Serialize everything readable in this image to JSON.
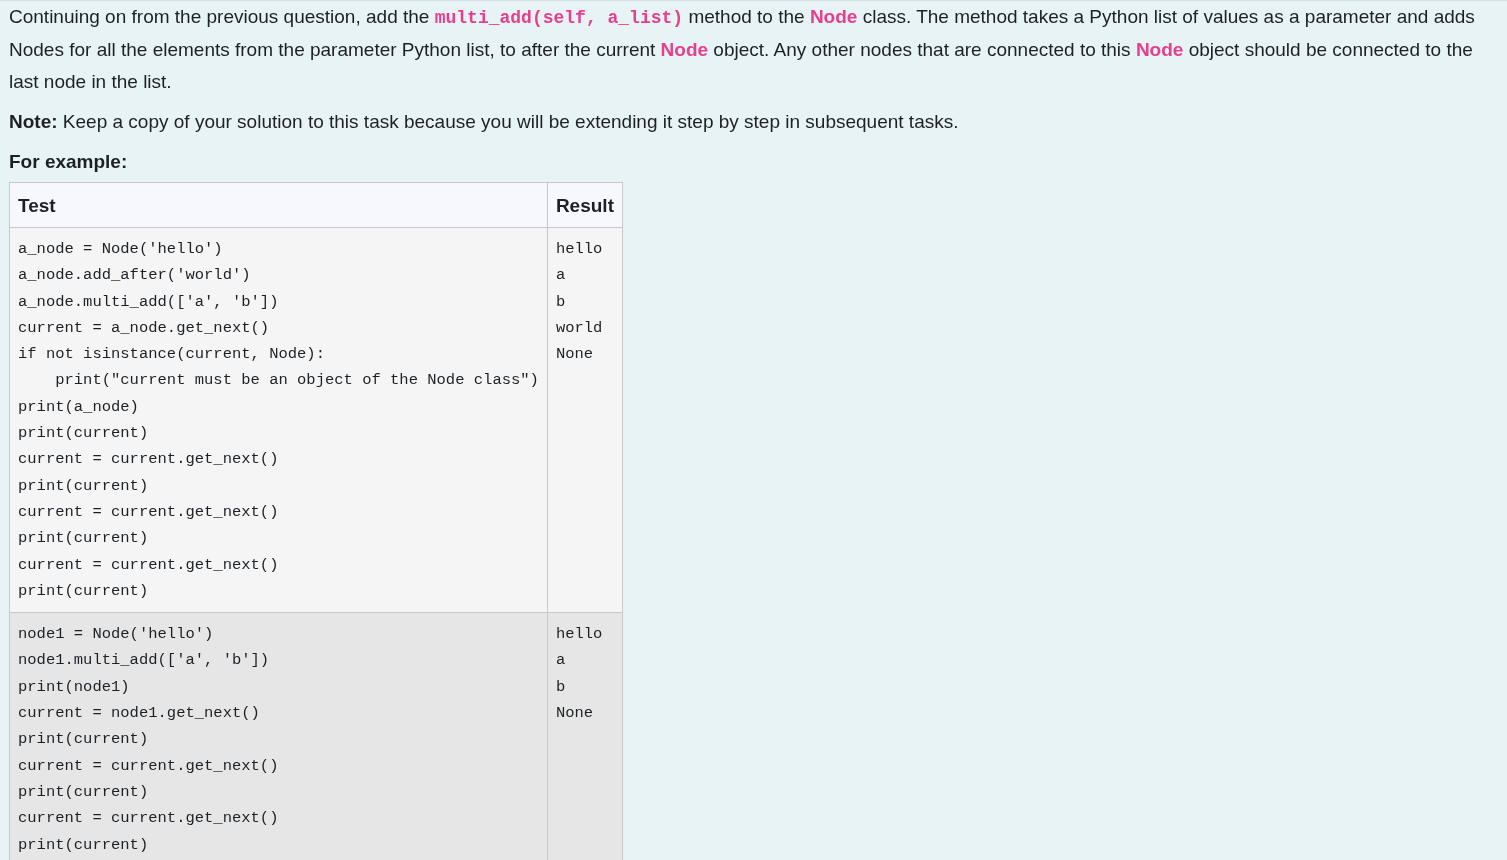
{
  "question": {
    "paragraphs": [
      {
        "kind": "body",
        "segments": [
          {
            "kind": "plain",
            "text": "Continuing on from the previous question, add the "
          },
          {
            "kind": "code",
            "text": "multi_add(self, a_list)"
          },
          {
            "kind": "plain",
            "text": " method to the "
          },
          {
            "kind": "class",
            "text": "Node"
          },
          {
            "kind": "plain",
            "text": " class. The method takes a Python list of values as a parameter and adds Nodes for all the elements from the parameter Python list, to after the current "
          },
          {
            "kind": "class",
            "text": "Node"
          },
          {
            "kind": "plain",
            "text": " object. Any other nodes that are connected to this "
          },
          {
            "kind": "class",
            "text": "Node"
          },
          {
            "kind": "plain",
            "text": " object should be connected to the last node in the list."
          }
        ]
      },
      {
        "kind": "body",
        "segments": [
          {
            "kind": "bold",
            "text": "Note:"
          },
          {
            "kind": "plain",
            "text": " Keep a copy of your solution to this task because you will be extending it step by step in subsequent tasks."
          }
        ]
      },
      {
        "kind": "heading",
        "segments": [
          {
            "kind": "bold",
            "text": "For example:"
          }
        ]
      }
    ]
  },
  "table": {
    "columns": [
      "Test",
      "Result"
    ],
    "rows": [
      {
        "test": [
          "a_node = Node('hello')",
          "a_node.add_after('world')",
          "a_node.multi_add(['a', 'b'])",
          "current = a_node.get_next()",
          "if not isinstance(current, Node):",
          "    print(\"current must be an object of the Node class\")",
          "print(a_node)",
          "print(current)",
          "current = current.get_next()",
          "print(current)",
          "current = current.get_next()",
          "print(current)",
          "current = current.get_next()",
          "print(current)"
        ],
        "result": [
          "hello",
          "a",
          "b",
          "world",
          "None"
        ]
      },
      {
        "test": [
          "node1 = Node('hello')",
          "node1.multi_add(['a', 'b'])",
          "print(node1)",
          "current = node1.get_next()",
          "print(current)",
          "current = current.get_next()",
          "print(current)",
          "current = current.get_next()",
          "print(current)"
        ],
        "result": [
          "hello",
          "a",
          "b",
          "None"
        ]
      }
    ]
  }
}
